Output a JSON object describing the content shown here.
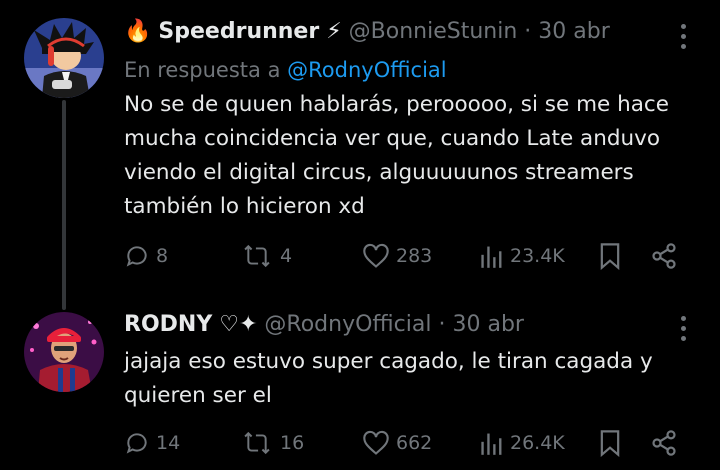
{
  "tweets": [
    {
      "display_name": "Speedrunner",
      "name_prefix_emoji": "🔥",
      "name_suffix_emoji": "⚡",
      "handle": "@BonnieStunin",
      "separator": "·",
      "date": "30 abr",
      "reply_label": "En respuesta a",
      "reply_handle": "@RodnyOfficial",
      "text": "No se de quuen hablarás, perooooo, si se me hace mucha coincidencia ver que, cuando Late anduvo viendo el digital circus, alguuuuunos streamers también lo hicieron xd",
      "stats": {
        "replies": "8",
        "retweets": "4",
        "likes": "283",
        "views": "23.4K"
      }
    },
    {
      "display_name": "RODNY",
      "name_suffix_emoji": "♡✦",
      "handle": "@RodnyOfficial",
      "separator": "·",
      "date": "30 abr",
      "text": "jajaja eso estuvo super cagado, le tiran cagada y quieren ser el",
      "stats": {
        "replies": "14",
        "retweets": "16",
        "likes": "662",
        "views": "26.4K"
      }
    }
  ],
  "colors": {
    "background": "#000000",
    "text": "#e7e9ea",
    "muted": "#71767b",
    "link": "#1d9bf0",
    "thread_line": "#333639"
  },
  "icons": [
    "reply-icon",
    "retweet-icon",
    "like-icon",
    "views-icon",
    "bookmark-icon",
    "share-icon",
    "more-icon"
  ]
}
